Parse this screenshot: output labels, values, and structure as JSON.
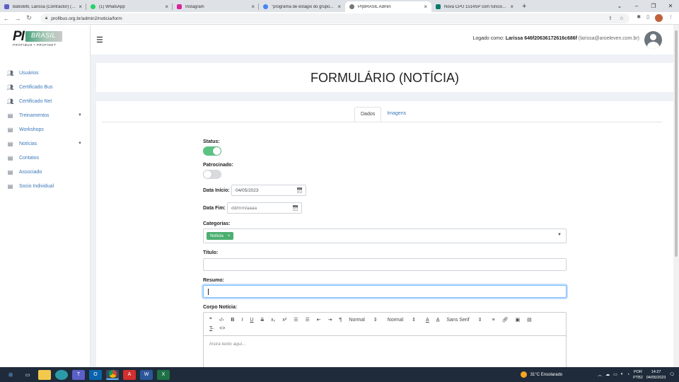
{
  "browser": {
    "tabs": [
      {
        "title": "Batistetti, Larissa (Contractor) (W...",
        "color": "#5b5fc7"
      },
      {
        "title": "(1) WhatsApp",
        "color": "#25d366"
      },
      {
        "title": "Instagram",
        "color": "#d6249f"
      },
      {
        "title": "\"programa de estágio do grupo...",
        "color": "#4285f4"
      },
      {
        "title": "PI|BRASIL Admin",
        "color": "#777777"
      },
      {
        "title": "Nova CPU 1514SP com funciona...",
        "color": "#0a7b6c"
      }
    ],
    "url": "profibus.org.br/admin2/noticia/form"
  },
  "sidebar": {
    "logo_text": "PI",
    "logo_brand": "BRASIL",
    "logo_sub": "PROFIBUS • PROFINET",
    "items": [
      {
        "label": "Usuários",
        "icon": "users-icon"
      },
      {
        "label": "Certificado Bus",
        "icon": "users-icon"
      },
      {
        "label": "Certificado Net",
        "icon": "users-icon"
      },
      {
        "label": "Treinamentos",
        "icon": "list-icon",
        "expandable": true
      },
      {
        "label": "Workshops",
        "icon": "list-icon"
      },
      {
        "label": "Notícias",
        "icon": "list-icon",
        "expandable": true
      },
      {
        "label": "Contatos",
        "icon": "list-icon"
      },
      {
        "label": "Associado",
        "icon": "list-icon"
      },
      {
        "label": "Socio Individual",
        "icon": "list-icon"
      }
    ]
  },
  "header": {
    "logged_prefix": "Logado como:",
    "user_name": "Larissa 646f20636172616c686f",
    "user_email": "(larissa@aroeleven.com.br)"
  },
  "page": {
    "title": "FORMULÁRIO (NOTÍCIA)",
    "tabs": [
      "Dados",
      "Imagens"
    ]
  },
  "form": {
    "status_label": "Status:",
    "status_on": true,
    "patrocinado_label": "Patrocinado:",
    "patrocinado_on": false,
    "data_inicio_label": "Data Início:",
    "data_inicio_value": "04/05/2023",
    "data_fim_label": "Data Fim:",
    "data_fim_placeholder": "dd/mm/aaaa",
    "categorias_label": "Categorias:",
    "categoria_chip": "Notícia",
    "titulo_label": "Título:",
    "resumo_label": "Resumo:",
    "corpo_label": "Corpo Notícia:",
    "editor": {
      "size_label": "Normal",
      "header_label": "Normal",
      "font_label": "Sans Serif",
      "placeholder": "Insira texto aqui..."
    }
  },
  "taskbar": {
    "weather": "31°C  Ensolarado",
    "lang": "POR",
    "lang_sub": "PTB2",
    "time": "14:27",
    "date": "04/05/2023"
  },
  "colors": {
    "accent": "#3b77b8",
    "toggle_on": "#5cc282",
    "chip": "#4cae70"
  }
}
